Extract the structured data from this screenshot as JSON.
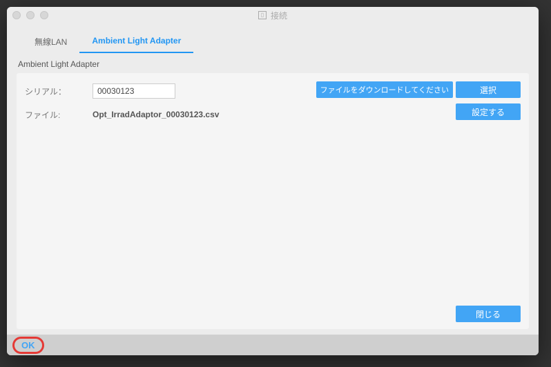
{
  "window": {
    "title": "接続"
  },
  "tabs": {
    "wireless": "無線LAN",
    "adapter": "Ambient Light Adapter"
  },
  "section": {
    "heading": "Ambient Light Adapter"
  },
  "form": {
    "serial_label": "シリアル：",
    "serial_value": "00030123",
    "file_label": "ファイル:",
    "file_value": "Opt_IrradAdaptor_00030123.csv"
  },
  "buttons": {
    "download_msg": "ファイルをダウンロードしてください",
    "select": "選択",
    "configure": "設定する",
    "close": "閉じる",
    "ok": "OK"
  }
}
